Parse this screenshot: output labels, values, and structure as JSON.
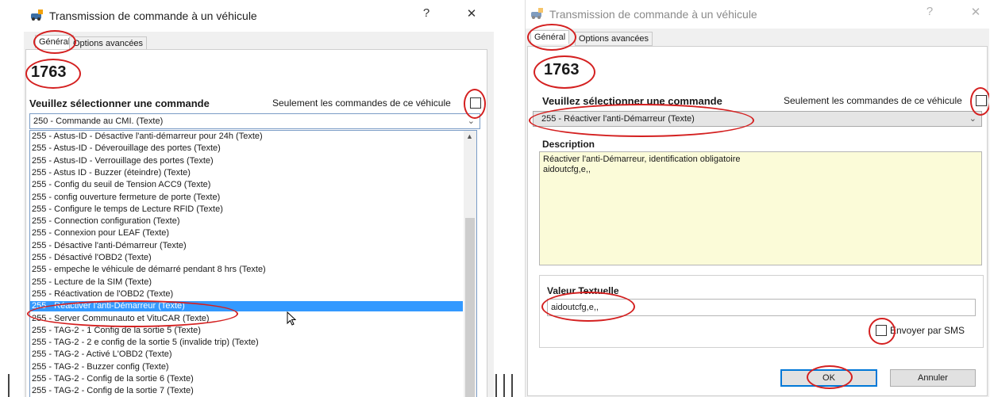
{
  "left_window": {
    "title": "Transmission de commande à un véhicule",
    "help_button": "?",
    "close_button": "✕",
    "tabs": [
      "Général",
      "Options avancées"
    ],
    "vehicle_id": "1763",
    "select_label": "Veuillez sélectionner une commande",
    "only_vehicle_label": "Seulement les commandes de ce véhicule",
    "combo_value": "250 - Commande au CMI.    (Texte)",
    "dropdown_items": [
      "255 - Astus-ID - Désactive l'anti-démarreur pour 24h    (Texte)",
      "255 - Astus-ID - Déverouillage des portes    (Texte)",
      "255 - Astus-ID - Verrouillage des portes    (Texte)",
      "255 - Astus ID - Buzzer (éteindre)    (Texte)",
      "255 - Config du seuil de Tension ACC9    (Texte)",
      "255 - config ouverture fermeture de porte    (Texte)",
      "255 - Configure le temps de Lecture RFID    (Texte)",
      "255 - Connection configuration    (Texte)",
      "255 - Connexion pour LEAF    (Texte)",
      "255 - Désactive l'anti-Démarreur    (Texte)",
      "255 - Désactivé l'OBD2    (Texte)",
      "255 - empeche le véhicule de démarré pendant 8 hrs    (Texte)",
      "255 - Lecture de la SIM    (Texte)",
      "255 - Réactivation de l'OBD2    (Texte)",
      "255 - Réactiver l'anti-Démarreur    (Texte)",
      "255 - Server Communauto et VituCAR    (Texte)",
      "255 - TAG-2 - 1 Config de la sortie 5    (Texte)",
      "255 - TAG-2 - 2 e config de la sortie 5 (invalide trip)    (Texte)",
      "255 - TAG-2 - Activé L'OBD2    (Texte)",
      "255 - TAG-2 - Buzzer config    (Texte)",
      "255 - TAG-2 - Config de la sortie 6    (Texte)",
      "255 - TAG-2 - Config de la sortie 7    (Texte)"
    ],
    "selected_index": 14
  },
  "right_window": {
    "title": "Transmission de commande à un véhicule",
    "help_button": "?",
    "close_button": "✕",
    "tabs": [
      "Général",
      "Options avancées"
    ],
    "vehicle_id": "1763",
    "select_label": "Veuillez sélectionner une commande",
    "only_vehicle_label": "Seulement les commandes de ce véhicule",
    "combo_value": "255 - Réactiver l'anti-Démarreur    (Texte)",
    "description_label": "Description",
    "description_text": "Réactiver l'anti-Démarreur, identification obligatoire\naidoutcfg,e,,",
    "text_value_label": "Valeur Textuelle",
    "text_value": "aidoutcfg,e,,",
    "sms_label": "Envoyer par SMS",
    "ok_button": "OK",
    "cancel_button": "Annuler"
  },
  "colors": {
    "annotation": "#d42020",
    "selection": "#3399ff",
    "description_bg": "#fbfbd8"
  }
}
